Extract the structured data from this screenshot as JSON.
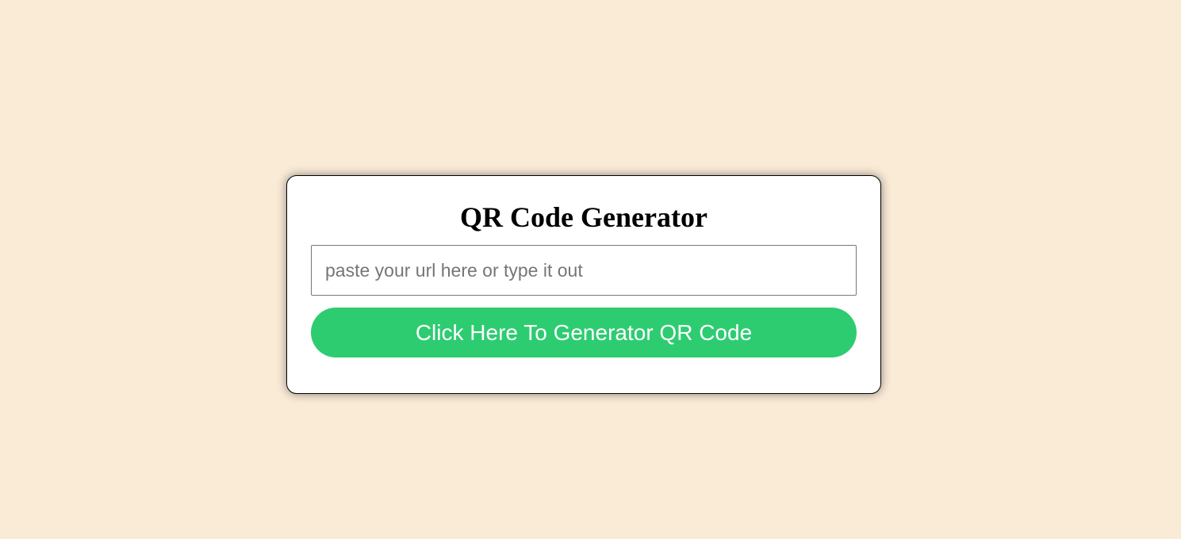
{
  "app": {
    "title": "QR Code Generator"
  },
  "form": {
    "url_input": {
      "value": "",
      "placeholder": "paste your url here or type it out"
    },
    "generate_button_label": "Click Here To Generator QR Code"
  },
  "colors": {
    "page_background": "#faebd7",
    "card_background": "#ffffff",
    "button_background": "#2ecc71",
    "button_text": "#ffffff"
  }
}
